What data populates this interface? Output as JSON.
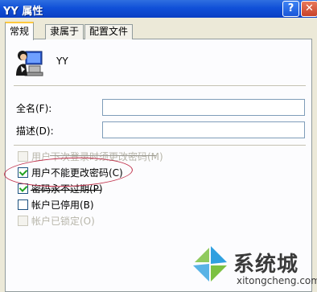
{
  "window": {
    "title": "YY 属性",
    "help_glyph": "?",
    "close_glyph": "✕"
  },
  "tabs": [
    {
      "label": "常规",
      "active": true
    },
    {
      "label": "隶属于",
      "active": false
    },
    {
      "label": "配置文件",
      "active": false
    }
  ],
  "user": {
    "name": "YY",
    "icon": "user-at-computer-icon"
  },
  "fields": {
    "full_name": {
      "label": "全名(F):",
      "value": ""
    },
    "description": {
      "label": "描述(D):",
      "value": ""
    }
  },
  "options": [
    {
      "label": "用户下次登录时须更改密码(M)",
      "checked": false,
      "enabled": false
    },
    {
      "label": "用户不能更改密码(C)",
      "checked": true,
      "enabled": true
    },
    {
      "label": "密码永不过期(P)",
      "checked": true,
      "enabled": true
    },
    {
      "label": "帐户已停用(B)",
      "checked": false,
      "enabled": true
    },
    {
      "label": "帐户已锁定(O)",
      "checked": false,
      "enabled": false
    }
  ],
  "watermark": {
    "name": "系统城",
    "url": "xitongcheng.com"
  },
  "colors": {
    "titlebar": "#0a3fc4",
    "annotation": "#c0304a",
    "check": "#21a121"
  }
}
